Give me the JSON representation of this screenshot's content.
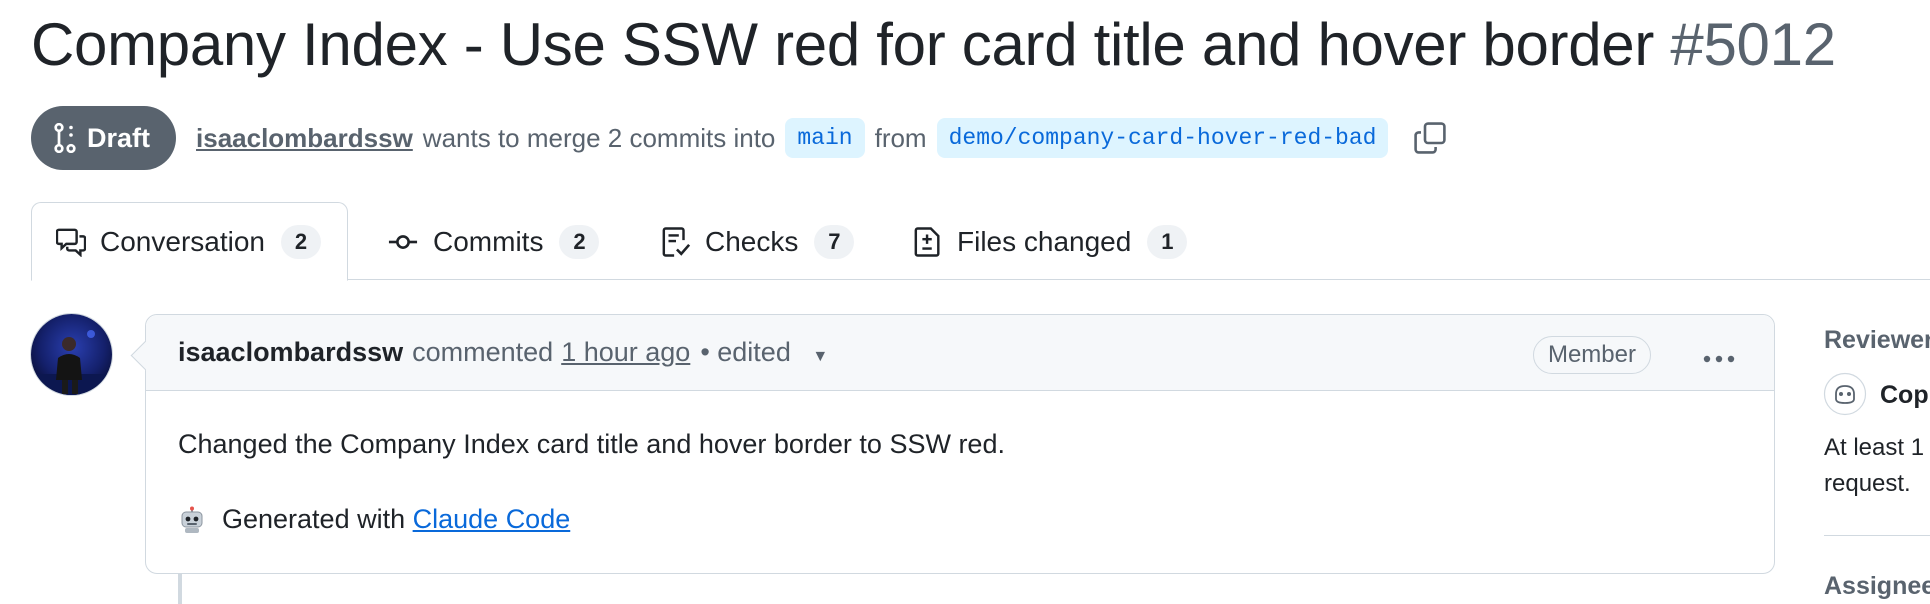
{
  "pr": {
    "title": "Company Index - Use SSW red for card title and hover border",
    "number": "#5012",
    "status": "Draft",
    "author": "isaaclombardssw",
    "merge_text": "wants to merge 2 commits into",
    "base_branch": "main",
    "from_text": "from",
    "head_branch": "demo/company-card-hover-red-bad"
  },
  "tabs": [
    {
      "label": "Conversation",
      "count": "2",
      "icon": "comment-discussion-icon"
    },
    {
      "label": "Commits",
      "count": "2",
      "icon": "git-commit-icon"
    },
    {
      "label": "Checks",
      "count": "7",
      "icon": "checklist-icon"
    },
    {
      "label": "Files changed",
      "count": "1",
      "icon": "file-diff-icon"
    }
  ],
  "comment": {
    "author": "isaaclombardssw",
    "action": "commented",
    "time": "1 hour ago",
    "edited": "• edited",
    "badge": "Member",
    "body_line1": "Changed the Company Index card title and hover border to SSW red.",
    "generated_prefix": "Generated with",
    "generated_link": "Claude Code"
  },
  "sidebar": {
    "reviewers_heading": "Reviewer",
    "reviewer_name": "Copi",
    "reviewer_note_line1": "At least 1",
    "reviewer_note_line2": "request.",
    "assignees_heading": "Assignee"
  },
  "colors": {
    "draft_bg": "#59636e",
    "link": "#0969da",
    "branch_bg": "#ddf4ff",
    "border": "#d1d9e0"
  }
}
